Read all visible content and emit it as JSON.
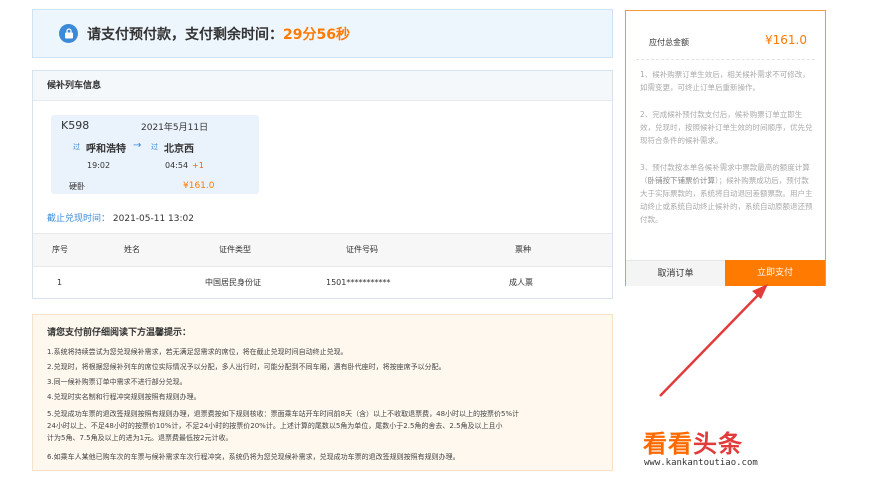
{
  "banner": {
    "text": "请支付预付款，支付剩余时间：",
    "time": "29分56秒"
  },
  "train_panel": {
    "title": "候补列车信息",
    "train_no": "K598",
    "date": "2021年5月11日",
    "pass_mark": "过",
    "from": "呼和浩特",
    "to": "北京西",
    "depart": "19:02",
    "arrive": "04:54",
    "arrive_plus": "+1",
    "seat": "硬卧",
    "price": "¥161.0",
    "deadline_label": "截止兑现时间：",
    "deadline_value": "2021-05-11 13:02"
  },
  "table": {
    "headers": [
      "序号",
      "姓名",
      "证件类型",
      "证件号码",
      "票种"
    ],
    "rows": [
      [
        "1",
        "",
        "中国居民身份证",
        "1501***********",
        "成人票"
      ]
    ]
  },
  "notice": {
    "title": "请您支付前仔细阅读下方温馨提示：",
    "lines": [
      "1.系统将持续尝试为您兑现候补需求，若无满足您需求的席位，将在截止兑现时间自动终止兑现。",
      "2.兑现时，将根据您候补列车的席位实际情况予以分配，多人出行时，可能分配到不同车厢，遇有卧代座时，将按座席予以分配。",
      "3.同一候补购票订单中需求不进行部分兑现。",
      "4.兑现时实名制和行程冲突规则按照有规则办理。",
      "5.兑现成功车票的退改签规则按照有规则办理，退票费按如下规则核收：票面乘车站开车时间前8天（含）以上不收取退票费，48小时以上的按票价5%计",
      "24小时以上、不足48小时的按票价10%计，不足24小时的按票价20%计。上述计算的尾数以5角为单位，尾数小于2.5角的舍去、2.5角及以上且小",
      "计为5角、7.5角及以上的进为1元。退票费最低按2元计收。",
      "6.如乘车人某他已购车次的车票与候补需求车次行程冲突，系统仍将为您兑现候补需求，兑现成功车票的退改签规则按照有规则办理。"
    ]
  },
  "summary": {
    "total_label": "应付总金额",
    "total_value": "¥161.0",
    "rule1": "1、候补购票订单生效后，相关候补需求不可修改，如需变更，可终止订单后重新操作。",
    "rule2": "2、完成候补预付款支付后，候补购票订单立即生效，兑现时，按照候补订单生效的时间顺序，优先兑现符合条件的候补需求。",
    "rule3_pre": "3、预付款按本单各候补需求中票款最高的额度计算（",
    "rule3_bold": "卧铺按下铺票价计算",
    "rule3_post": "）；候补购票成功后，预付款大于实际票款的，系统将自动退回差额票款。用户主动终止或系统自动终止候补的，系统自动原额退还预付款。",
    "cancel_label": "取消订单",
    "pay_label": "立即支付"
  },
  "watermark": {
    "logo": "看看头条",
    "url": "www.kankantoutiao.com"
  },
  "colors": {
    "accent": "#ff7a00",
    "link": "#3b8ad9",
    "arrow": "#e23b3b"
  }
}
